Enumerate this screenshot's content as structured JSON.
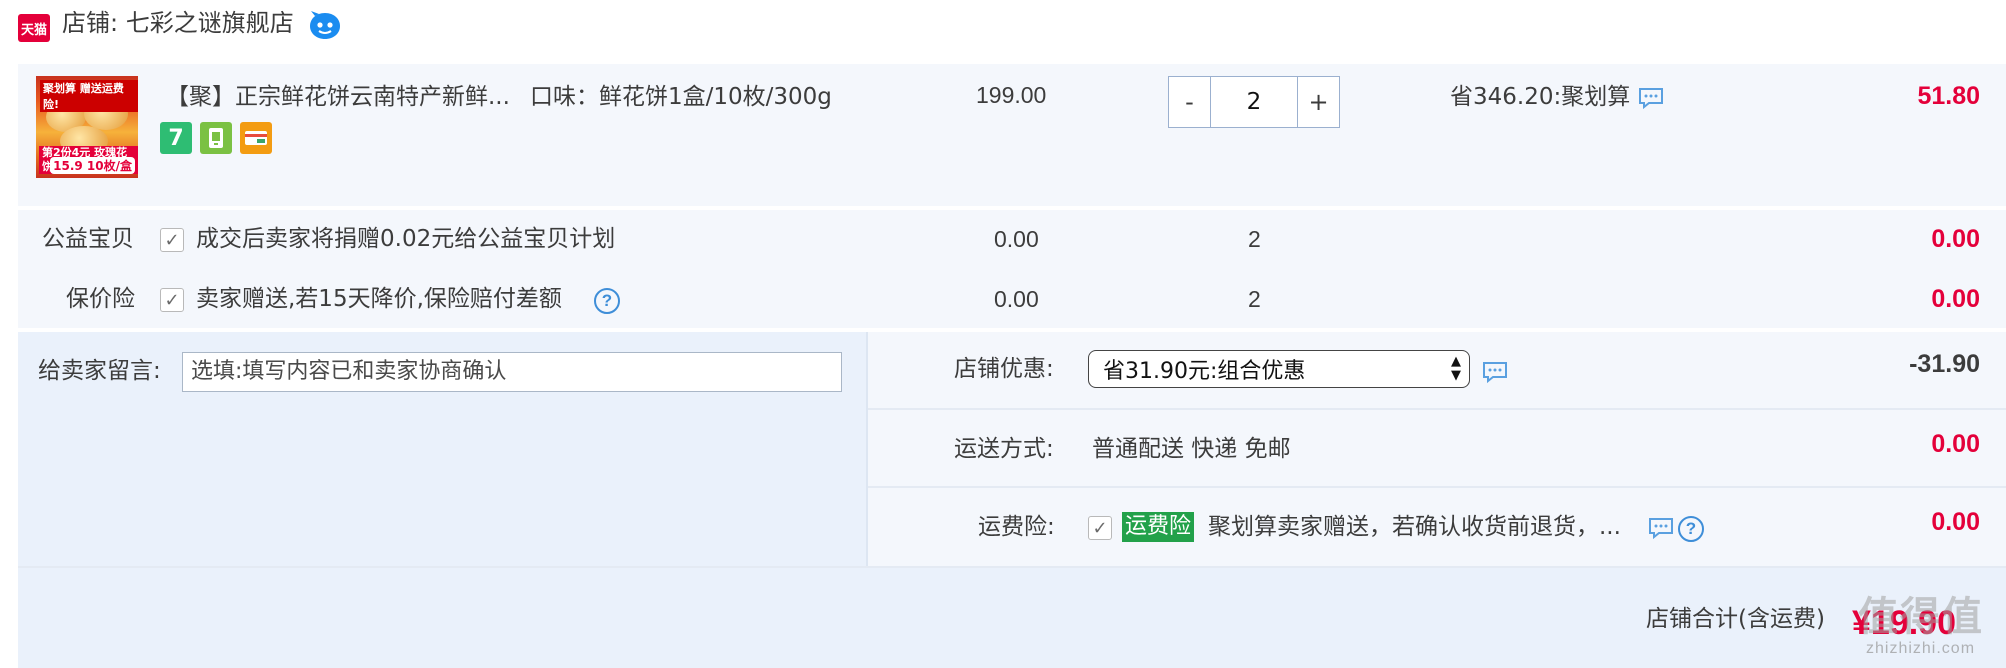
{
  "shop": {
    "logo_text": "天猫",
    "label": "店铺: 七彩之谜旗舰店"
  },
  "item": {
    "image_tags": {
      "top": "聚划算 赠送运费险!",
      "bottom": "第2份4元 玫瑰花饼",
      "price_tag": "15.9 10枚/盒"
    },
    "title": "【聚】正宗鲜花饼云南特产新鲜...",
    "sku": "口味：鲜花饼1盒/10枚/300g",
    "badges": [
      "7",
      "phone",
      "card"
    ],
    "unit_price": "199.00",
    "qty_minus": "-",
    "qty_value": "2",
    "qty_plus": "+",
    "discount": "省346.20:聚划算",
    "subtotal": "51.80"
  },
  "services": [
    {
      "label": "公益宝贝",
      "desc": "成交后卖家将捐赠0.02元给公益宝贝计划",
      "price": "0.00",
      "qty": "2",
      "subtotal": "0.00",
      "checked": true,
      "help": false
    },
    {
      "label": "保价险",
      "desc": "卖家赠送,若15天降价,保险赔付差额",
      "price": "0.00",
      "qty": "2",
      "subtotal": "0.00",
      "checked": true,
      "help": true
    }
  ],
  "message": {
    "label": "给卖家留言:",
    "placeholder": "选填:填写内容已和卖家协商确认"
  },
  "shop_discount": {
    "label": "店铺优惠:",
    "selected": "省31.90元:组合优惠",
    "amount": "-31.90"
  },
  "shipping": {
    "label": "运送方式:",
    "value": "普通配送 快递 免邮",
    "amount": "0.00"
  },
  "freight_insurance": {
    "label": "运费险:",
    "tag": "运费险",
    "desc": "聚划算卖家赠送，若确认收货前退货，...",
    "amount": "0.00",
    "checked": true
  },
  "total": {
    "label": "店铺合计(含运费)",
    "value": "¥19.90"
  },
  "watermark": {
    "main": "值得值",
    "sub": "zhizhizhi.com"
  },
  "colors": {
    "price_red": "#e4003a",
    "row_bg": "#f4f7fc",
    "lower_bg": "#eaf1fb",
    "link_blue": "#3e8ed8",
    "tag_green": "#22a14a"
  }
}
